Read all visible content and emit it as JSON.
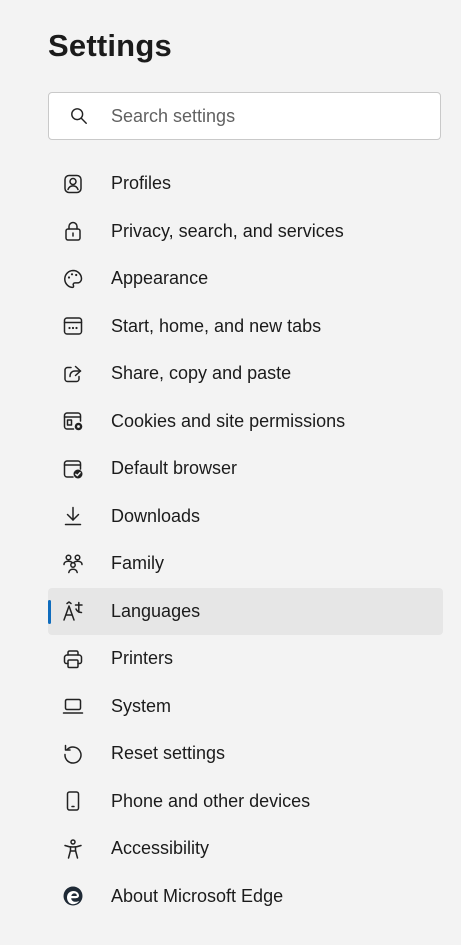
{
  "header": {
    "title": "Settings"
  },
  "search": {
    "placeholder": "Search settings",
    "icon": "search-icon"
  },
  "nav": {
    "active_index": 9,
    "accent_color": "#0f6cbd",
    "items": [
      {
        "label": "Profiles",
        "icon": "profile-icon"
      },
      {
        "label": "Privacy, search, and services",
        "icon": "lock-icon"
      },
      {
        "label": "Appearance",
        "icon": "palette-icon"
      },
      {
        "label": "Start, home, and new tabs",
        "icon": "new-tab-icon"
      },
      {
        "label": "Share, copy and paste",
        "icon": "share-icon"
      },
      {
        "label": "Cookies and site permissions",
        "icon": "cookies-icon"
      },
      {
        "label": "Default browser",
        "icon": "default-browser-icon"
      },
      {
        "label": "Downloads",
        "icon": "download-icon"
      },
      {
        "label": "Family",
        "icon": "family-icon"
      },
      {
        "label": "Languages",
        "icon": "languages-icon"
      },
      {
        "label": "Printers",
        "icon": "printer-icon"
      },
      {
        "label": "System",
        "icon": "laptop-icon"
      },
      {
        "label": "Reset settings",
        "icon": "reset-icon"
      },
      {
        "label": "Phone and other devices",
        "icon": "phone-icon"
      },
      {
        "label": "Accessibility",
        "icon": "accessibility-icon"
      },
      {
        "label": "About Microsoft Edge",
        "icon": "edge-logo-icon"
      }
    ]
  }
}
